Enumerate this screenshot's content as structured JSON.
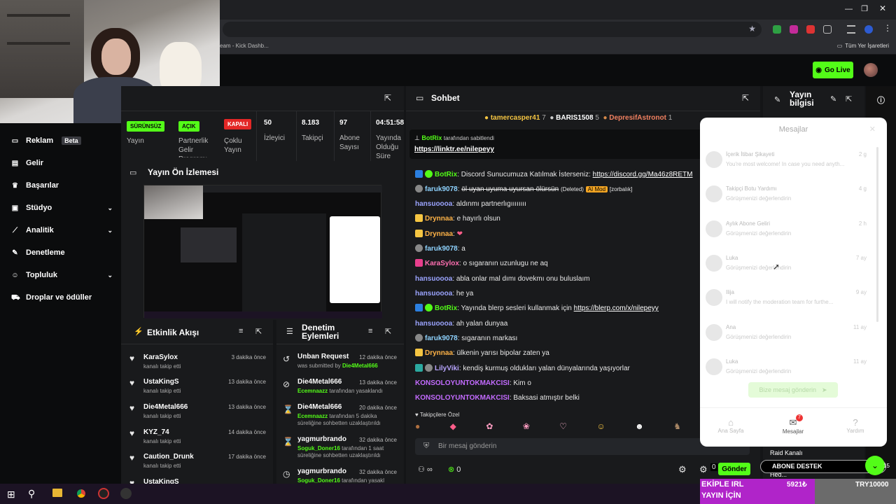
{
  "browser": {
    "tab_title": "eam - Kick Dashb...",
    "bookmarks_label": "Tüm Yer İşaretleri"
  },
  "app": {
    "go_live": "Go Live"
  },
  "sidebar": {
    "items": [
      {
        "label": "Reklam",
        "badge": "Beta",
        "icon": "monitor-icon"
      },
      {
        "label": "Gelir",
        "icon": "chart-icon"
      },
      {
        "label": "Başarılar",
        "icon": "trophy-icon"
      },
      {
        "label": "Stüdyo",
        "icon": "studio-icon",
        "chevron": true
      },
      {
        "label": "Analitik",
        "icon": "analytics-icon",
        "chevron": true
      },
      {
        "label": "Denetleme",
        "icon": "wrench-icon"
      },
      {
        "label": "Topluluk",
        "icon": "people-icon",
        "chevron": true
      },
      {
        "label": "Droplar ve ödüller",
        "icon": "gift-icon"
      }
    ]
  },
  "stats": {
    "status_pill": "SÜRÜNSÜZ",
    "partner_pill": "AÇIK",
    "kapali_pill": "KAPALI",
    "yayin": "Yayın",
    "partner": "Partnerlik Gelir Programı",
    "coklu": "Çoklu Yayın",
    "viewers_val": "50",
    "viewers": "İzleyici",
    "followers_val": "8.183",
    "followers": "Takipçi",
    "subs_val": "97",
    "subs": "Abone Sayısı",
    "uptime_val": "04:51:58",
    "uptime": "Yayında Olduğu Süre"
  },
  "preview": {
    "title": "Yayın Ön İzlemesi"
  },
  "etkinlik": {
    "title": "Etkinlik Akışı",
    "rows": [
      {
        "name": "KaraSylox",
        "sub": "kanalı takip etti",
        "time": "3 dakika önce"
      },
      {
        "name": "UstaKingS",
        "sub": "kanalı takip etti",
        "time": "13 dakika önce"
      },
      {
        "name": "Die4Metal666",
        "sub": "kanalı takip etti",
        "time": "13 dakika önce"
      },
      {
        "name": "KYZ_74",
        "sub": "kanalı takip etti",
        "time": "14 dakika önce"
      },
      {
        "name": "Caution_Drunk",
        "sub": "kanalı takip etti",
        "time": "17 dakika önce"
      },
      {
        "name": "UstaKingS",
        "sub": "",
        "time": ""
      }
    ]
  },
  "denetim": {
    "title": "Denetim Eylemleri",
    "rows": [
      {
        "name": "Unban Request",
        "time": "12 dakika önce",
        "sub": "was submitted by ",
        "actor": "Die4Metal666",
        "icon": "history-icon"
      },
      {
        "name": "Die4Metal666",
        "time": "13 dakika önce",
        "actor": "Ecemnaazz",
        "sub": " tarafından yasaklandı",
        "icon": "ban-icon"
      },
      {
        "name": "Die4Metal666",
        "time": "20 dakika önce",
        "actor": "Ecemnaazz",
        "sub": " tarafından 5 dakika süreliğine sohbetten uzaklaştırıldı",
        "icon": "hourglass-icon"
      },
      {
        "name": "yagmurbrando",
        "time": "32 dakika önce",
        "actor": "Soguk_Doner16",
        "sub": " tarafından 1 saat süreliğine sohbetten uzaklaştırıldı",
        "icon": "hourglass-icon"
      },
      {
        "name": "yagmurbrando",
        "time": "32 dakika önce",
        "actor": "Soguk_Doner16",
        "sub": " tarafından yasakl",
        "icon": "clock-icon"
      }
    ]
  },
  "chat": {
    "title": "Sohbet",
    "top_gifters": [
      {
        "name": "tamercasper41",
        "count": "7"
      },
      {
        "name": "BARIS1508",
        "count": "5"
      },
      {
        "name": "DepresifAstronot",
        "count": "1"
      }
    ],
    "pinned_by": "BotRix",
    "pinned_text": "tarafından sabitlendi",
    "pinned_link": "https://linktr.ee/nilepeyy",
    "messages": [
      {
        "user": "BotRix",
        "color": "#53fc18",
        "text": "Discord Sunucumuza Katılmak İsterseniz: ",
        "link": "https://discord.gg/Ma46z8RETM"
      },
      {
        "user": "faruk9078",
        "color": "#8fd3ff",
        "text": "öl uyan uyuma uyursan ölürsün",
        "deleted": "(Deleted)",
        "tag": "AI Mod",
        "extra": "[zorbalık]"
      },
      {
        "user": "hansuoooa",
        "color": "#9ba4ff",
        "text": "aldınmı partnerlıgıııııııı"
      },
      {
        "user": "Drynnaa",
        "color": "#ffb347",
        "text": "e hayırlı olsun"
      },
      {
        "user": "Drynnaa",
        "color": "#ffb347",
        "text": ""
      },
      {
        "user": "faruk9078",
        "color": "#8fd3ff",
        "text": "a"
      },
      {
        "user": "KaraSylox",
        "color": "#ff6fb1",
        "text": "o sıgaranın uzunlugu ne aq"
      },
      {
        "user": "hansuoooa",
        "color": "#9ba4ff",
        "text": "abla onlar mal dımı dovekmı onu buluslaım"
      },
      {
        "user": "hansuoooa",
        "color": "#9ba4ff",
        "text": "he ya"
      },
      {
        "user": "BotRix",
        "color": "#53fc18",
        "text": "Yayında blerp sesleri kullanmak için ",
        "link": "https://blerp.com/x/nilepeyy"
      },
      {
        "user": "hansuoooa",
        "color": "#9ba4ff",
        "text": "ah yalan dunyaa"
      },
      {
        "user": "faruk9078",
        "color": "#8fd3ff",
        "text": "sıgaranın markası"
      },
      {
        "user": "Drynnaa",
        "color": "#ffb347",
        "text": "ülkenin yarısı bipolar zaten ya"
      },
      {
        "user": "LilyViki",
        "color": "#b9a6ff",
        "text": "kendiş kurmuş oldukları yalan dünyalarında yaşıyorlar"
      },
      {
        "user": "KONSOLOYUNTOKMAKCISI",
        "color": "#c36bff",
        "text": "Kim o"
      },
      {
        "user": "KONSOLOYUNTOKMAKCISI",
        "color": "#c36bff",
        "text": "Baksasi atmıştır belki"
      }
    ],
    "followers_only": "Takipçilere Özel",
    "input_placeholder": "Bir mesaj gönderin",
    "count": "0",
    "points": "0",
    "send": "Gönder"
  },
  "info": {
    "title": "Yayın bilgisi",
    "raid": "Raid Kanalı",
    "hed": "Hed..."
  },
  "messages": {
    "title": "Mesajlar",
    "rows": [
      {
        "name": "İçerik İtibar Şikayeti",
        "time": "2 g",
        "preview": "You're most welcome! In case you need anyth..."
      },
      {
        "name": "Takipçi Botu Yardımı",
        "time": "4 g",
        "preview": "Görüşmenizi değerlendirin"
      },
      {
        "name": "Aylık Abone Geliri",
        "time": "2 h",
        "preview": "Görüşmenizi değerlendirin"
      },
      {
        "name": "Luka",
        "time": "7 ay",
        "preview": "Görüşmenizi değerlendirin"
      },
      {
        "name": "Ilija",
        "time": "9 ay",
        "preview": "I will notify the moderation team for furthe..."
      },
      {
        "name": "Ana",
        "time": "11 ay",
        "preview": "Görüşmenizi değerlendirin"
      },
      {
        "name": "Luka",
        "time": "11 ay",
        "preview": "Görüşmenizi değerlendirin"
      }
    ],
    "send_btn": "Bize mesaj gönderin",
    "nav": [
      "Ana Sayfa",
      "Mesajlar",
      "Yardım"
    ],
    "badge": "7"
  },
  "promo": {
    "abone": "ABONE DESTEK",
    "line1": "EKİPLE IRL",
    "line2": "YAYIN İÇİN",
    "amount": "5921₺",
    "target": "TRY10000",
    "count": "15"
  }
}
